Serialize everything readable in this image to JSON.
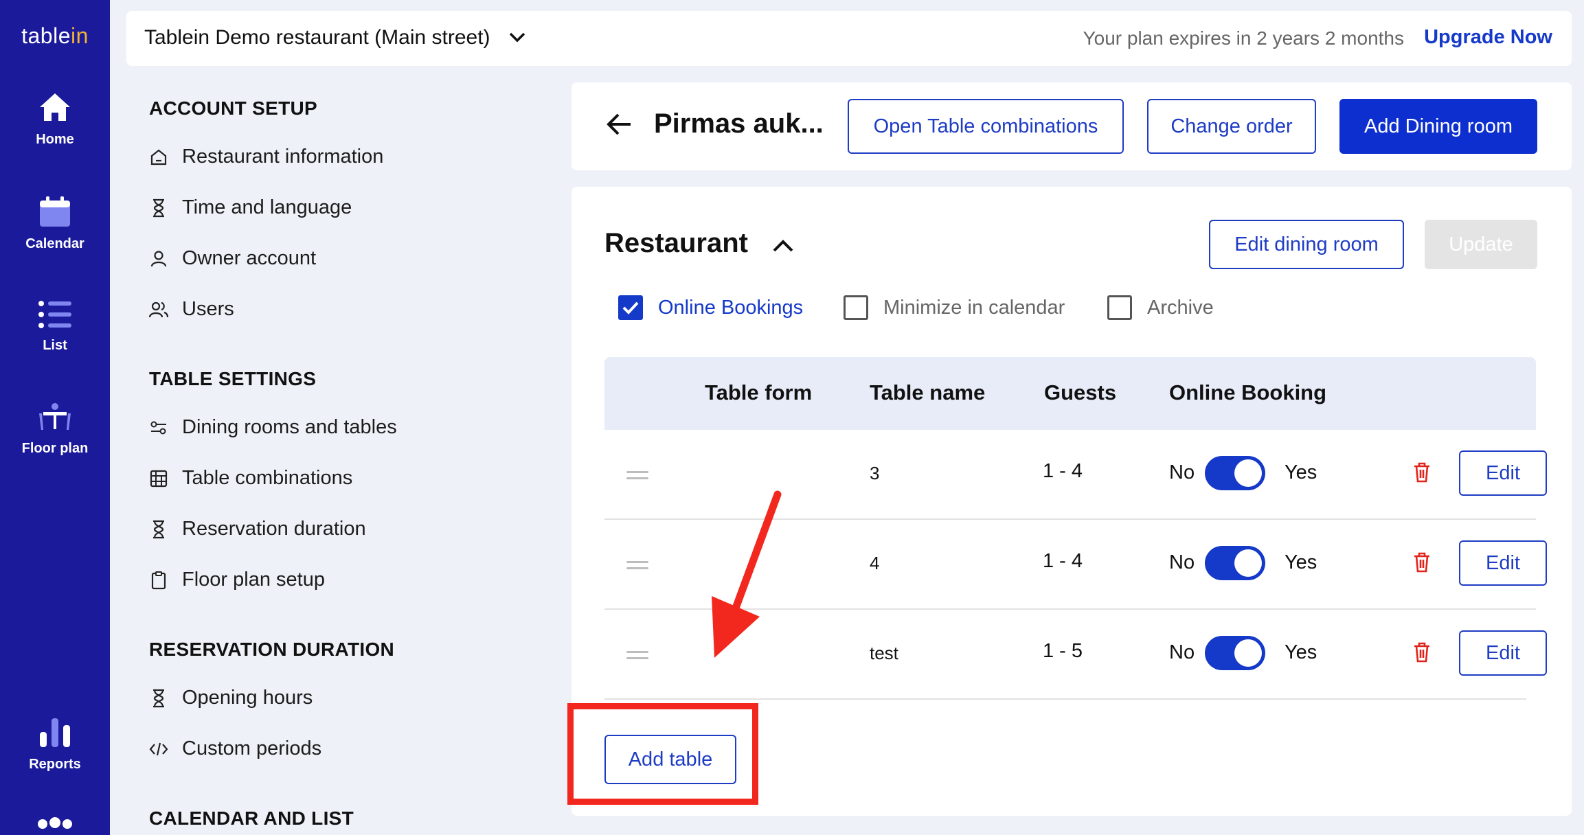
{
  "brand": {
    "logo_main": "table",
    "logo_accent": "in"
  },
  "rail": {
    "items": [
      {
        "label": "Home",
        "icon": "home-icon"
      },
      {
        "label": "Calendar",
        "icon": "calendar-icon"
      },
      {
        "label": "List",
        "icon": "list-icon"
      },
      {
        "label": "Floor plan",
        "icon": "floor-plan-icon"
      },
      {
        "label": "Reports",
        "icon": "reports-icon"
      }
    ]
  },
  "topbar": {
    "venue": "Tablein Demo restaurant (Main street)",
    "plan_text": "Your plan expires in 2 years 2 months",
    "upgrade": "Upgrade Now"
  },
  "nav": {
    "account_heading": "ACCOUNT SETUP",
    "account_items": [
      "Restaurant information",
      "Time and language",
      "Owner account",
      "Users"
    ],
    "table_heading": "TABLE SETTINGS",
    "table_items": [
      "Dining rooms and tables",
      "Table combinations",
      "Reservation duration",
      "Floor plan setup"
    ],
    "reservation_heading": "RESERVATION DURATION",
    "reservation_items": [
      "Opening hours",
      "Custom periods"
    ],
    "calendar_heading": "CALENDAR AND LIST"
  },
  "header": {
    "title": "Pirmas auk...",
    "open_combinations": "Open Table combinations",
    "change_order": "Change order",
    "add_dining_room": "Add Dining room"
  },
  "section": {
    "title": "Restaurant",
    "edit_dining_room": "Edit dining room",
    "update": "Update",
    "checkboxes": [
      {
        "label": "Online Bookings",
        "checked": true
      },
      {
        "label": "Minimize in calendar",
        "checked": false
      },
      {
        "label": "Archive",
        "checked": false
      }
    ]
  },
  "table": {
    "columns": [
      "Table form",
      "Table name",
      "Guests",
      "Online Booking"
    ],
    "rows": [
      {
        "name": "3",
        "guests": "1 - 4",
        "no": "No",
        "yes": "Yes",
        "online": true,
        "edit": "Edit"
      },
      {
        "name": "4",
        "guests": "1 - 4",
        "no": "No",
        "yes": "Yes",
        "online": true,
        "edit": "Edit"
      },
      {
        "name": "test",
        "guests": "1 - 5",
        "no": "No",
        "yes": "Yes",
        "online": true,
        "edit": "Edit"
      }
    ],
    "add_table": "Add table"
  },
  "colors": {
    "rail": "#1b1a9a",
    "accent": "#1539c9",
    "logo_accent": "#f2b233",
    "danger": "#e0241b",
    "annotation": "#f2281f"
  }
}
